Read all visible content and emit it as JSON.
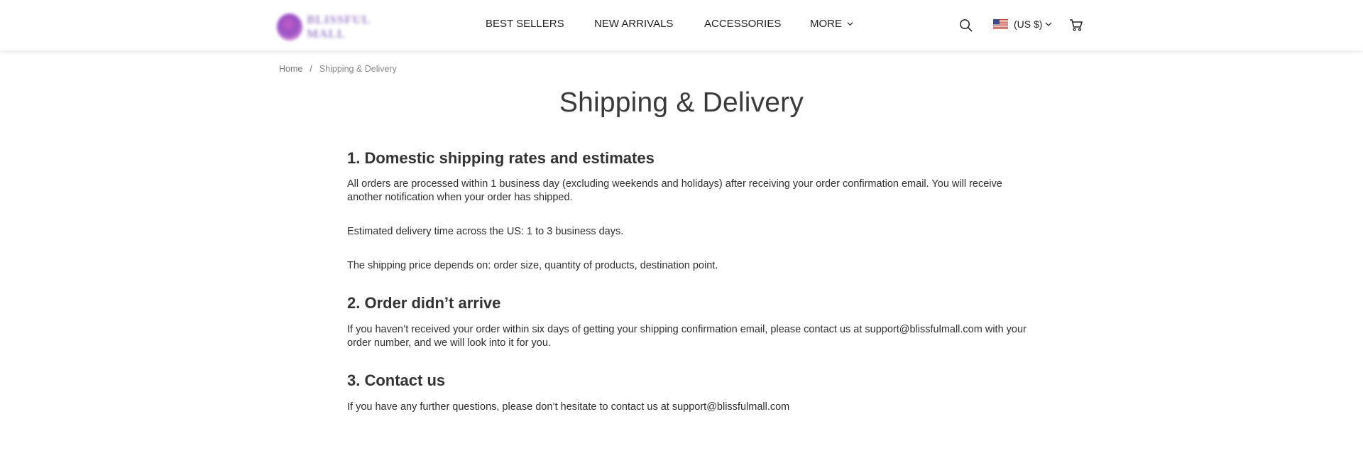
{
  "header": {
    "logo_text": "BLISSFUL MALL",
    "nav": [
      {
        "label": "BEST SELLERS"
      },
      {
        "label": "NEW ARRIVALS"
      },
      {
        "label": "ACCESSORIES"
      },
      {
        "label": "MORE"
      }
    ],
    "currency_label": "(US $)",
    "icons": {
      "search": "search-icon",
      "flag": "us-flag-icon",
      "cart": "cart-icon"
    }
  },
  "breadcrumb": {
    "home": "Home",
    "separator": "/",
    "current": "Shipping & Delivery"
  },
  "page": {
    "title": "Shipping & Delivery",
    "sections": [
      {
        "heading": "1. Domestic shipping rates and estimates",
        "paragraphs": [
          "All orders are processed within 1 business day (excluding weekends and holidays) after receiving your order confirmation email. You will receive another notification when your order has shipped.",
          "Estimated delivery time across the US: 1 to 3 business days.",
          "The shipping price depends on: order size, quantity of products, destination point."
        ]
      },
      {
        "heading": "2. Order didn’t arrive",
        "paragraphs": [
          "If you haven’t received your order within six days of getting your shipping confirmation email, please contact us at support@blissfulmall.com with your order number, and we will look into it for you."
        ]
      },
      {
        "heading": "3. Contact us",
        "paragraphs": [
          "If you have any further questions, please don’t hesitate to contact us at support@blissfulmall.com"
        ]
      }
    ]
  },
  "colors": {
    "text": "#333333",
    "muted": "#777777",
    "header_bg": "#ffffff"
  }
}
